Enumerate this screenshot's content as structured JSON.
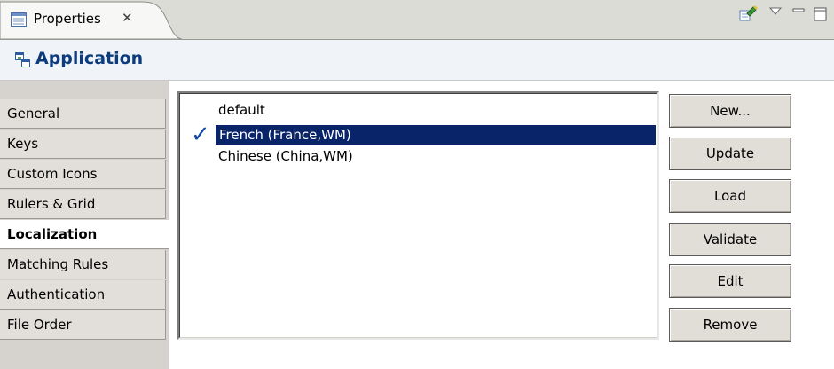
{
  "view": {
    "tab_title": "Properties",
    "tab_icon": "properties-view-icon",
    "close_icon": "close-icon",
    "toolbar_icons": [
      "pin-editor-icon",
      "view-menu-icon",
      "minimize-icon",
      "maximize-icon"
    ]
  },
  "header": {
    "icon": "application-icon",
    "title": "Application",
    "title_color": "#0d3c7d"
  },
  "sidebar": {
    "items": [
      {
        "label": "General"
      },
      {
        "label": "Keys"
      },
      {
        "label": "Custom Icons"
      },
      {
        "label": "Rulers & Grid"
      },
      {
        "label": "Localization",
        "active": true
      },
      {
        "label": "Matching Rules"
      },
      {
        "label": "Authentication"
      },
      {
        "label": "File Order"
      }
    ]
  },
  "locales": {
    "items": [
      {
        "label": "default",
        "checked": false,
        "selected": false
      },
      {
        "label": "French (France,WM)",
        "checked": true,
        "selected": true
      },
      {
        "label": "Chinese (China,WM)",
        "checked": false,
        "selected": false
      }
    ],
    "selection_color": "#0a246a",
    "check_icon": "checkmark-icon"
  },
  "buttons": {
    "new": "New...",
    "update": "Update",
    "load": "Load",
    "validate": "Validate",
    "edit": "Edit",
    "remove": "Remove"
  }
}
